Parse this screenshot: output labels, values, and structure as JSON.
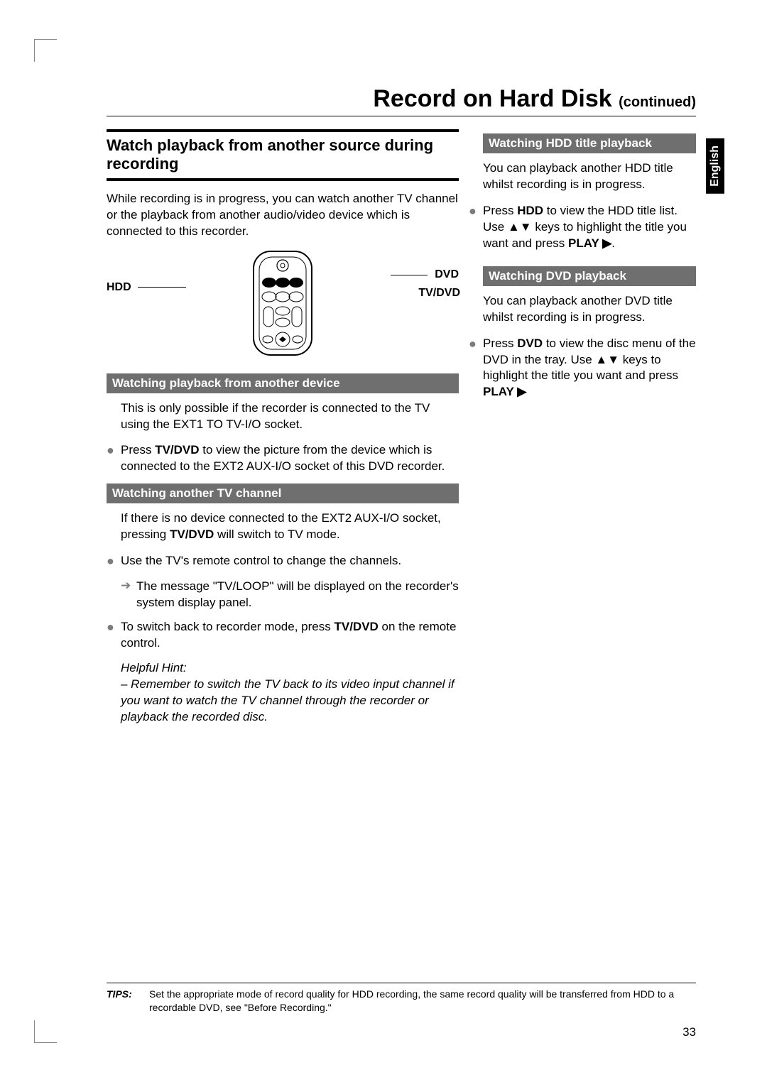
{
  "page": {
    "title": "Record on Hard Disk",
    "title_cont": "(continued)",
    "language": "English",
    "number": "33"
  },
  "left": {
    "section_head": "Watch playback from another source during recording",
    "intro": "While recording is in progress, you can watch another TV channel or the playback from another audio/video device which is connected to this recorder.",
    "labels": {
      "hdd": "HDD",
      "dvd": "DVD",
      "tvdvd": "TV/DVD"
    },
    "sub1": "Watching playback from another device",
    "p1": "This is only possible if the recorder is connected to the TV using the EXT1 TO TV-I/O socket.",
    "b1_pre": "Press ",
    "b1_bold": "TV/DVD",
    "b1_post": " to view the picture from the device which is connected to the EXT2 AUX-I/O socket of this DVD recorder.",
    "sub2": "Watching another TV channel",
    "p2_pre": "If there is no device connected to the EXT2 AUX-I/O socket, pressing ",
    "p2_bold": "TV/DVD",
    "p2_post": " will switch to TV mode.",
    "b2": "Use the TV's remote control to change the channels.",
    "arrow2": "The message \"TV/LOOP\" will be displayed on the recorder's system display panel.",
    "b3_pre": "To switch back to recorder mode, press ",
    "b3_bold": "TV/DVD",
    "b3_post": " on the remote control.",
    "hint_label": "Helpful Hint:",
    "hint_body": "– Remember to switch the TV back to its video input channel if you want to watch the TV channel through the recorder or playback the recorded disc."
  },
  "right": {
    "sub1": "Watching HDD title playback",
    "p1": "You can playback another HDD title whilst recording is in progress.",
    "b1_pre": "Press ",
    "b1_bold1": "HDD",
    "b1_mid": " to view the HDD title list. Use ▲▼ keys to highlight the title you want and press ",
    "b1_bold2": "PLAY ▶",
    "b1_post": ".",
    "sub2": "Watching DVD playback",
    "p2": "You can playback another DVD title whilst recording is in progress.",
    "b2_pre": "Press ",
    "b2_bold1": "DVD",
    "b2_mid": " to view the disc menu of the DVD in the tray. Use ▲▼ keys to highlight the title you want and press ",
    "b2_bold2": "PLAY ▶"
  },
  "tips": {
    "label": "TIPS:",
    "text": "Set the appropriate mode of record quality for HDD recording, the same record quality will be transferred from HDD to a recordable DVD, see \"Before Recording.\""
  }
}
